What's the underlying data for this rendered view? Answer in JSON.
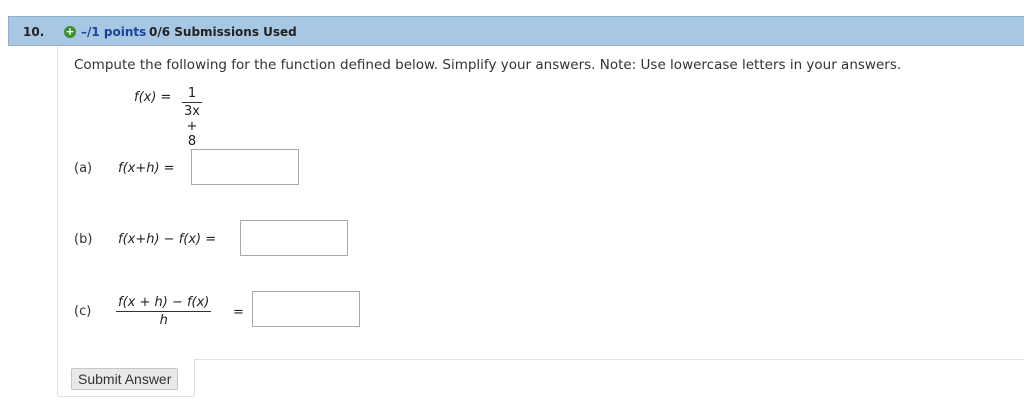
{
  "question": {
    "number": "10.",
    "add_icon": "plus-circle-icon",
    "points": "–/1 points",
    "submissions": "0/6 Submissions Used"
  },
  "prompt": "Compute the following for the function defined below. Simplify your answers. Note: Use lowercase letters in your answers.",
  "function_def": {
    "lhs": "f(x) =",
    "numerator": "1",
    "denominator": "3x + 8"
  },
  "parts": [
    {
      "label": "(a)",
      "expression": "f(x+h) =",
      "answer": ""
    },
    {
      "label": "(b)",
      "expression": "f(x+h) − f(x) =",
      "answer": ""
    },
    {
      "label": "(c)",
      "numerator": "f(x + h) − f(x)",
      "denominator": "h",
      "equals": "=",
      "answer": ""
    }
  ],
  "submit_label": "Submit Answer",
  "colors": {
    "header_bg": "#a8c7e2",
    "points_text": "#1a44a0",
    "add_icon": "#3a8f2e"
  }
}
